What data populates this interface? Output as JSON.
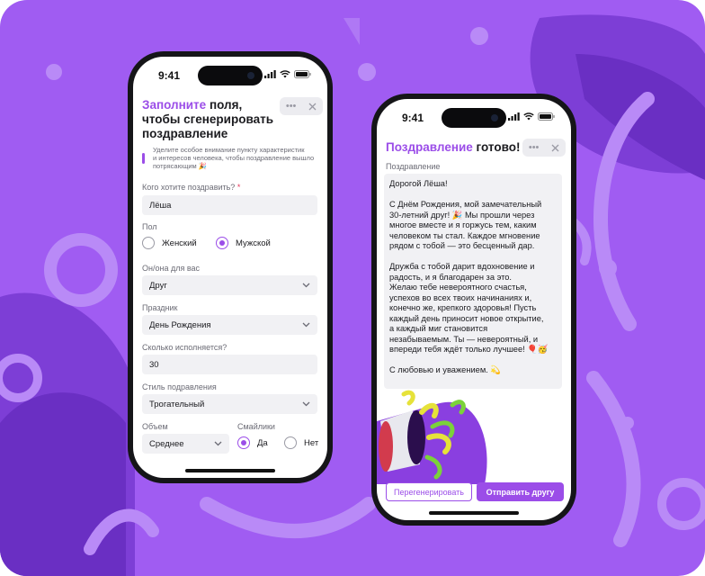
{
  "colors": {
    "background": "#a05cf2",
    "accent": "#9b4de8",
    "field": "#f1f1f4"
  },
  "status": {
    "time": "9:41"
  },
  "form": {
    "title_accent": "Заполните",
    "title_rest_1": " поля,",
    "title_line2": "чтобы сгенерировать",
    "title_line3": "поздравление",
    "hint_line1": "Уделите особое внимание пункту характеристик",
    "hint_line2": "и интересов человека, чтобы поздравление вышло",
    "hint_line3": "потрясающим 🎉",
    "recipient": {
      "label": "Кого хотите поздравить?",
      "required_mark": "*",
      "value": "Лёша"
    },
    "gender": {
      "label": "Пол",
      "options": [
        "Женский",
        "Мужской"
      ],
      "selected": "Мужской"
    },
    "relation": {
      "label": "Он/она для вас",
      "value": "Друг"
    },
    "holiday": {
      "label": "Праздник",
      "value": "День Рождения"
    },
    "age": {
      "label": "Сколько исполняется?",
      "value": "30"
    },
    "style": {
      "label": "Стиль подравления",
      "value": "Трогательный"
    },
    "volume": {
      "label": "Объем",
      "value": "Среднее"
    },
    "emoji": {
      "label": "Смайлики",
      "options": [
        "Да",
        "Нет"
      ],
      "selected": "Да"
    }
  },
  "result": {
    "title_accent": "Поздравление",
    "title_rest": " готово!",
    "section_label": "Поздравление",
    "paragraphs": [
      "Дорогой Лёша!",
      "С Днём Рождения, мой замечательный\n30-летний друг! 🎉 Мы прошли через\nмногое вместе и я горжусь тем, каким\nчеловеком ты стал. Каждое мгновение\nрядом с тобой — это бесценный дар.",
      "Дружба с тобой дарит вдохновение и\nрадость, и я благодарен за это.\nЖелаю тебе невероятного счастья,\nуспехов во всех твоих начинаниях и,\nконечно же, крепкого здоровья! Пусть\nкаждый день приносит новое открытие,\nа каждый миг становится\nнезабываемым. Ты — невероятный, и\nвпереди тебя ждёт только лучшее! 🎈🥳",
      "С любовью и уважением. 💫"
    ],
    "regenerate_label": "Перегенерировать",
    "send_label": "Отправить другу"
  },
  "icons": [
    "more-icon",
    "close-icon",
    "signal-icon",
    "wifi-icon",
    "battery-icon",
    "chevron-down-icon",
    "party-popper-icon"
  ]
}
